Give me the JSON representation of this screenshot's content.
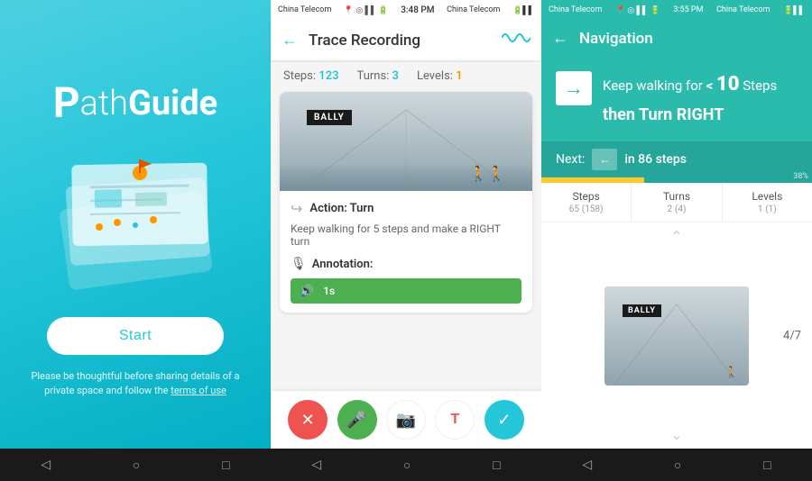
{
  "home": {
    "logo_prefix": "P",
    "logo_path": "ath",
    "logo_guide": "Guide",
    "illustration_alt": "map illustration",
    "start_button": "Start",
    "footer_text": "Please be thoughtful before sharing details of a private space and follow the ",
    "terms_text": "terms of use",
    "nav_icons": [
      "◁",
      "○",
      "□"
    ]
  },
  "trace": {
    "status_carrier": "China Telecom",
    "status_time": "3:48 PM",
    "status_carrier2": "China Telecom",
    "header_title": "Trace Recording",
    "back_icon": "←",
    "stats": {
      "steps_label": "Steps:",
      "steps_value": "123",
      "turns_label": "Turns:",
      "turns_value": "3",
      "levels_label": "Levels:",
      "levels_value": "1"
    },
    "action_icon": "→",
    "action_label": "Action: Turn",
    "action_desc": "Keep walking for 5 steps and make a RIGHT turn",
    "annotation_label": "Annotation:",
    "audio_duration": "1s",
    "bottom_buttons": {
      "cancel": "✕",
      "mic": "🎤",
      "camera": "📷",
      "text": "T",
      "confirm": "✓"
    },
    "nav_icons": [
      "◁",
      "○",
      "□"
    ]
  },
  "navigation": {
    "status_carrier": "China Telecom",
    "status_time": "3:55 PM",
    "header_title": "Navigation",
    "back_icon": "←",
    "instruction_main": "Keep walking for",
    "instruction_less_than": "< ",
    "instruction_steps": "10",
    "instruction_steps_word": " Steps",
    "instruction_turn": "then Turn RIGHT",
    "next_label": "Next:",
    "next_steps": "in 86 steps",
    "progress_pct": "38%",
    "stats": {
      "steps_label": "Steps",
      "steps_value": "65",
      "steps_total": "(158)",
      "turns_label": "Turns",
      "turns_value": "2",
      "turns_total": "(4)",
      "levels_label": "Levels",
      "levels_value": "1",
      "levels_total": "(1)"
    },
    "counter": "4/7",
    "nav_icons": [
      "◁",
      "○",
      "□"
    ]
  }
}
